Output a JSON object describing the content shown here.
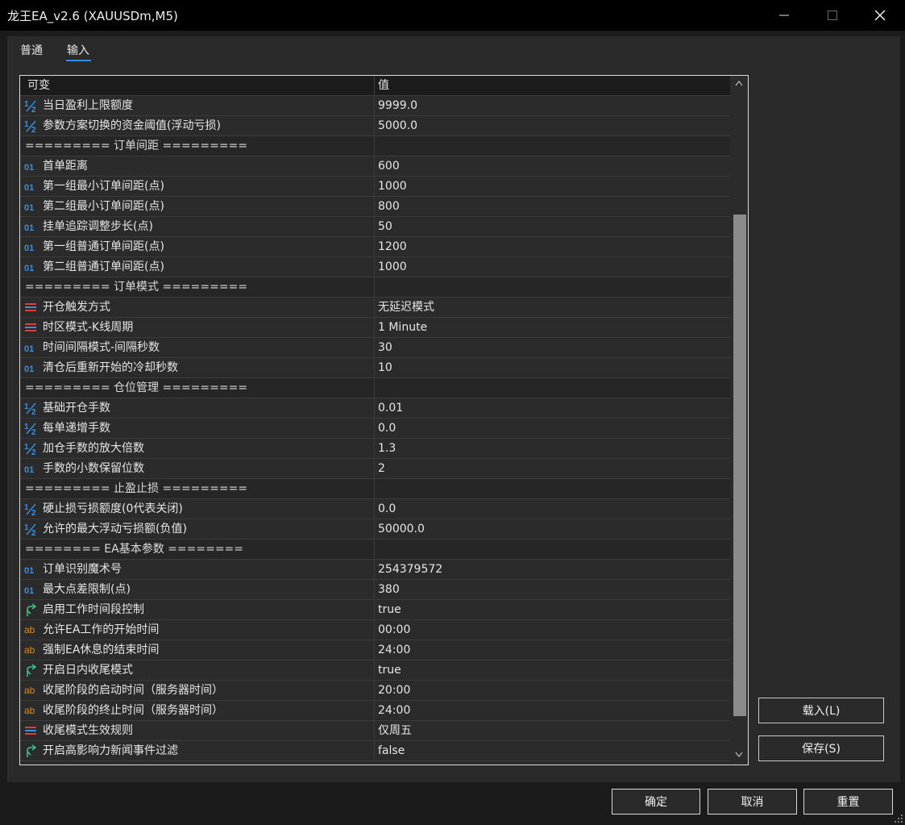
{
  "window": {
    "title": "龙王EA_v2.6 (XAUUSDm,M5)"
  },
  "tabs": [
    {
      "label": "普通"
    },
    {
      "label": "输入"
    }
  ],
  "table": {
    "header": {
      "name": "可变",
      "value": "值"
    },
    "rows": [
      {
        "kind": "param",
        "icon": "half",
        "name": "当日盈利上限额度",
        "value": "9999.0"
      },
      {
        "kind": "param",
        "icon": "half",
        "name": "参数方案切换的资金阈值(浮动亏损)",
        "value": "5000.0"
      },
      {
        "kind": "sep",
        "name": "========= 订单间距 =========",
        "value": ""
      },
      {
        "kind": "param",
        "icon": "int",
        "name": "首单距离",
        "value": "600"
      },
      {
        "kind": "param",
        "icon": "int",
        "name": "第一组最小订单间距(点)",
        "value": "1000"
      },
      {
        "kind": "param",
        "icon": "int",
        "name": "第二组最小订单间距(点)",
        "value": "800"
      },
      {
        "kind": "param",
        "icon": "int",
        "name": "挂单追踪调整步长(点)",
        "value": "50"
      },
      {
        "kind": "param",
        "icon": "int",
        "name": "第一组普通订单间距(点)",
        "value": "1200"
      },
      {
        "kind": "param",
        "icon": "int",
        "name": "第二组普通订单间距(点)",
        "value": "1000"
      },
      {
        "kind": "sep",
        "name": "========= 订单模式 =========",
        "value": ""
      },
      {
        "kind": "param",
        "icon": "enum",
        "name": "开仓触发方式",
        "value": "无延迟模式"
      },
      {
        "kind": "param",
        "icon": "enum",
        "name": "时区模式-K线周期",
        "value": "1 Minute"
      },
      {
        "kind": "param",
        "icon": "int",
        "name": "时间间隔模式-间隔秒数",
        "value": "30"
      },
      {
        "kind": "param",
        "icon": "int",
        "name": "清仓后重新开始的冷却秒数",
        "value": "10"
      },
      {
        "kind": "sep",
        "name": "========= 仓位管理 =========",
        "value": ""
      },
      {
        "kind": "param",
        "icon": "half",
        "name": "基础开仓手数",
        "value": "0.01"
      },
      {
        "kind": "param",
        "icon": "half",
        "name": "每单递增手数",
        "value": "0.0"
      },
      {
        "kind": "param",
        "icon": "half",
        "name": "加仓手数的放大倍数",
        "value": "1.3"
      },
      {
        "kind": "param",
        "icon": "int",
        "name": "手数的小数保留位数",
        "value": "2"
      },
      {
        "kind": "sep",
        "name": "========= 止盈止损 =========",
        "value": ""
      },
      {
        "kind": "param",
        "icon": "half",
        "name": "硬止损亏损额度(0代表关闭)",
        "value": "0.0"
      },
      {
        "kind": "param",
        "icon": "half",
        "name": "允许的最大浮动亏损额(负值)",
        "value": "50000.0"
      },
      {
        "kind": "sep",
        "name": "======== EA基本参数 ========",
        "value": ""
      },
      {
        "kind": "param",
        "icon": "int",
        "name": "订单识别魔术号",
        "value": "254379572"
      },
      {
        "kind": "param",
        "icon": "int",
        "name": "最大点差限制(点)",
        "value": "380"
      },
      {
        "kind": "param",
        "icon": "bool",
        "name": "启用工作时间段控制",
        "value": "true"
      },
      {
        "kind": "param",
        "icon": "str",
        "name": "允许EA工作的开始时间",
        "value": "00:00"
      },
      {
        "kind": "param",
        "icon": "str",
        "name": "强制EA休息的结束时间",
        "value": "24:00"
      },
      {
        "kind": "param",
        "icon": "bool",
        "name": "开启日内收尾模式",
        "value": "true"
      },
      {
        "kind": "param",
        "icon": "str",
        "name": "收尾阶段的启动时间（服务器时间）",
        "value": "20:00"
      },
      {
        "kind": "param",
        "icon": "str",
        "name": "收尾阶段的终止时间（服务器时间）",
        "value": "24:00"
      },
      {
        "kind": "param",
        "icon": "enum",
        "name": "收尾模式生效规则",
        "value": "仅周五"
      },
      {
        "kind": "param",
        "icon": "bool",
        "name": "开启高影响力新闻事件过滤",
        "value": "false"
      }
    ]
  },
  "side_buttons": {
    "load": "载入(L)",
    "save": "保存(S)"
  },
  "bottom_buttons": {
    "ok": "确定",
    "cancel": "取消",
    "reset": "重置"
  },
  "colors": {
    "icon_blue": "#3b8fe0",
    "icon_green": "#3cc08a",
    "icon_orange": "#d88a2c",
    "icon_red": "#d9403a"
  }
}
